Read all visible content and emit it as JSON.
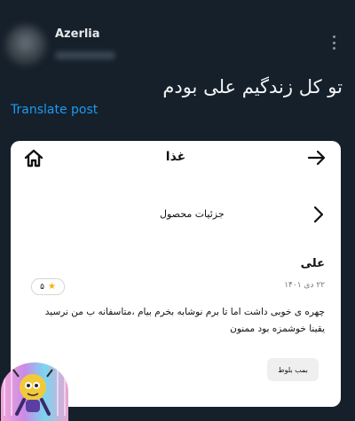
{
  "post": {
    "username": "Azerlia",
    "text": "تو کل زندگیم علی بودم",
    "translate_label": "Translate post"
  },
  "card": {
    "title": "غذا",
    "section_label": "جزئیات محصول",
    "review": {
      "reviewer": "علی",
      "rating": "۵",
      "date": "۲۲ دی ۱۴۰۱",
      "text": "چهره ی خوبی داشت اما تا برم نوشابه بخرم بیام ،متاسفانه ب من نرسید یقینا خوشمزه بود ممنون",
      "tag": "بمب بلوط"
    }
  },
  "icons": {
    "more": "more-vertical-icon",
    "home": "home-icon",
    "forward": "arrow-right-icon",
    "chevron": "chevron-right-icon",
    "star": "star-icon"
  },
  "colors": {
    "background": "#15202b",
    "link": "#1d9bf0",
    "card": "#ffffff",
    "star": "#f5b301"
  }
}
